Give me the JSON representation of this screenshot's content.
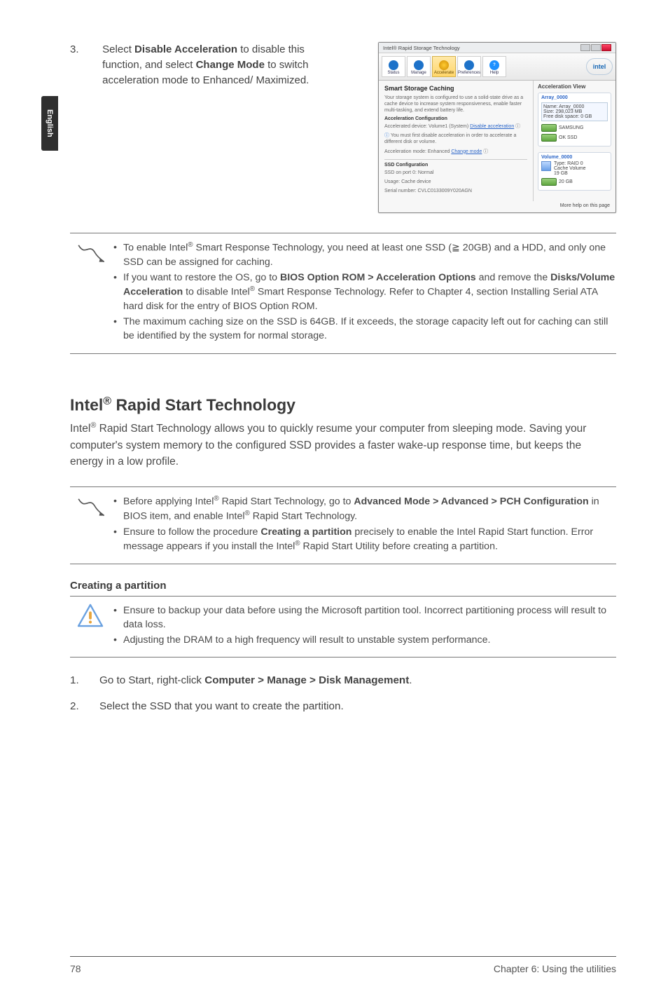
{
  "sideTab": "English",
  "step3": {
    "num": "3.",
    "text_pre": "Select ",
    "bold1": "Disable Acceleration",
    "text_mid1": " to disable this function, and select ",
    "bold2": "Change Mode",
    "text_mid2": " to switch acceleration mode to Enhanced/ Maximized."
  },
  "screenshot": {
    "title": "Intel® Rapid Storage Technology",
    "toolbar": {
      "status": "Status",
      "manage": "Manage",
      "accelerate": "Accelerate",
      "preferences": "Preferences",
      "help": "Help"
    },
    "logo": "intel",
    "left": {
      "heading": "Smart Storage Caching",
      "desc": "Your storage system is configured to use a solid-state drive as a cache device to increase system responsiveness, enable faster multi-tasking, and extend battery life.",
      "accConf": "Acceleration Configuration",
      "accDev": "Accelerated device: Volume1 (System) ",
      "disable": "Disable acceleration",
      "info": "You must first disable acceleration in order to accelerate a different disk or volume.",
      "mode": "Acceleration mode: Enhanced ",
      "change": "Change mode",
      "ssdConf": "SSD Configuration",
      "l1": "SSD on port 0: Normal",
      "l2": "Usage: Cache device",
      "l3": "Serial number: CVLC0133009Y020AGN"
    },
    "right": {
      "heading": "Acceleration View",
      "array": "Array_0000",
      "sysinfo1": "Name: Array_0000",
      "sysinfo2": "Size: 298,023 MB",
      "sysinfo3": "Free disk space: 0 GB",
      "dlabel1": "SAMSUNG",
      "dlabel2": "OK SSD",
      "cv": "Volume_0000",
      "cv1": "Type: RAID 0",
      "cv2": "Cache Volume",
      "cv3": "19 GB",
      "dlabel3": "20 GB"
    },
    "more": "More help on this page"
  },
  "note1": {
    "li1_a": "To enable Intel",
    "li1_b": " Smart Response Technology, you need at least one SSD (",
    "li1_ge": "≧",
    "li1_c": " 20GB) and a HDD, and only one SSD can be assigned for caching.",
    "li2_a": "If you want to restore the OS, go to ",
    "li2_bold": "BIOS Option ROM > Acceleration Options",
    "li2_b": " and remove the ",
    "li2_bold2": "Disks/Volume Acceleration",
    "li2_c": " to disable Intel",
    "li2_d": " Smart Response Technology. Refer to Chapter 4, section Installing Serial ATA hard disk for the entry of BIOS Option ROM.",
    "li3": "The maximum caching size on the SSD is 64GB. If it exceeds, the storage capacity left out for caching can still be identified by the system for normal storage."
  },
  "section": {
    "title_a": "Intel",
    "title_b": " Rapid Start Technology",
    "intro_a": "Intel",
    "intro_b": " Rapid Start Technology allows you to quickly resume your computer from sleeping mode. Saving your computer's system memory to the configured SSD provides a faster wake-up response time, but keeps the energy in a low profile."
  },
  "note2": {
    "li1_a": "Before applying Intel",
    "li1_b": " Rapid Start Technology, go to ",
    "li1_bold": "Advanced Mode > Advanced > PCH Configuration",
    "li1_c": " in BIOS item, and enable Intel",
    "li1_d": " Rapid Start Technology.",
    "li2_a": "Ensure to follow the procedure ",
    "li2_bold": "Creating a partition",
    "li2_b": " precisely to enable the Intel Rapid Start function. Error message appears if you install the Intel",
    "li2_c": " Rapid Start Utility before creating a partition."
  },
  "subhead": "Creating a partition",
  "warn": {
    "li1": "Ensure to backup your data before using the Microsoft partition tool. Incorrect partitioning process will result to data loss.",
    "li2": "Adjusting the DRAM to a high frequency will result to unstable system performance."
  },
  "steps": {
    "s1_num": "1.",
    "s1_a": "Go to Start, right-click ",
    "s1_bold": "Computer > Manage > Disk Management",
    "s1_b": ".",
    "s2_num": "2.",
    "s2": "Select the SSD that you want to create the partition."
  },
  "footer": {
    "page": "78",
    "chapter": "Chapter 6: Using the utilities"
  }
}
